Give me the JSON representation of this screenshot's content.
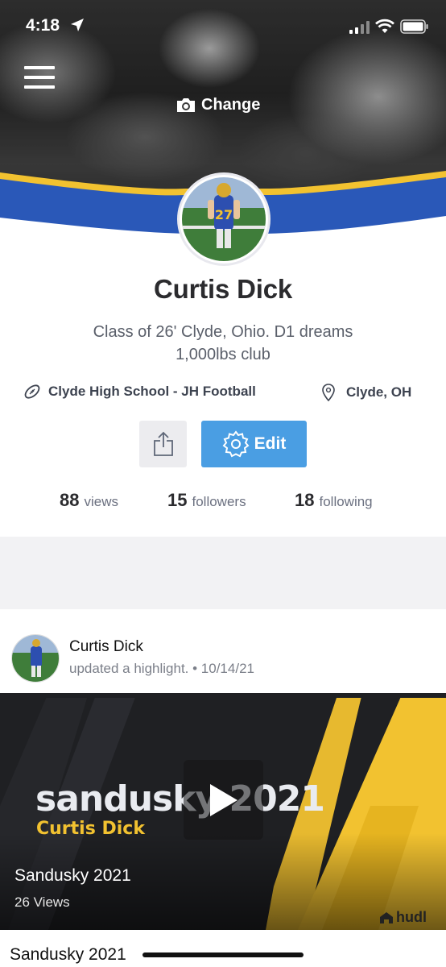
{
  "status_bar": {
    "time": "4:18"
  },
  "cover": {
    "change_label": "Change"
  },
  "profile": {
    "name": "Curtis Dick",
    "bio_line1": "Class of 26' Clyde, Ohio. D1 dreams",
    "bio_line2": "1,000lbs club",
    "team": "Clyde High School - JH Football",
    "location": "Clyde, OH",
    "edit_label": "Edit",
    "jersey_number": "27"
  },
  "stats": [
    {
      "value": "88",
      "label": "views"
    },
    {
      "value": "15",
      "label": "followers"
    },
    {
      "value": "18",
      "label": "following"
    }
  ],
  "feed": {
    "author": "Curtis Dick",
    "activity": "updated a highlight. • 10/14/21",
    "video": {
      "thumb_title": "sandusky 2021",
      "thumb_player": "Curtis Dick",
      "title": "Sandusky 2021",
      "views": "26 Views",
      "brand": "hudl"
    },
    "next_title": "Sandusky 2021"
  },
  "colors": {
    "primary_blue": "#4a9ee3",
    "banner_blue": "#2a58b8",
    "banner_gold": "#f2c230",
    "text_dark": "#2b2b2e",
    "text_muted": "#6b7080"
  },
  "icons": [
    "location-arrow-icon",
    "signal-icon",
    "wifi-icon",
    "battery-icon",
    "menu-icon",
    "camera-icon",
    "football-icon",
    "pin-icon",
    "share-icon",
    "gear-icon",
    "play-icon",
    "hudl-logo-icon"
  ]
}
